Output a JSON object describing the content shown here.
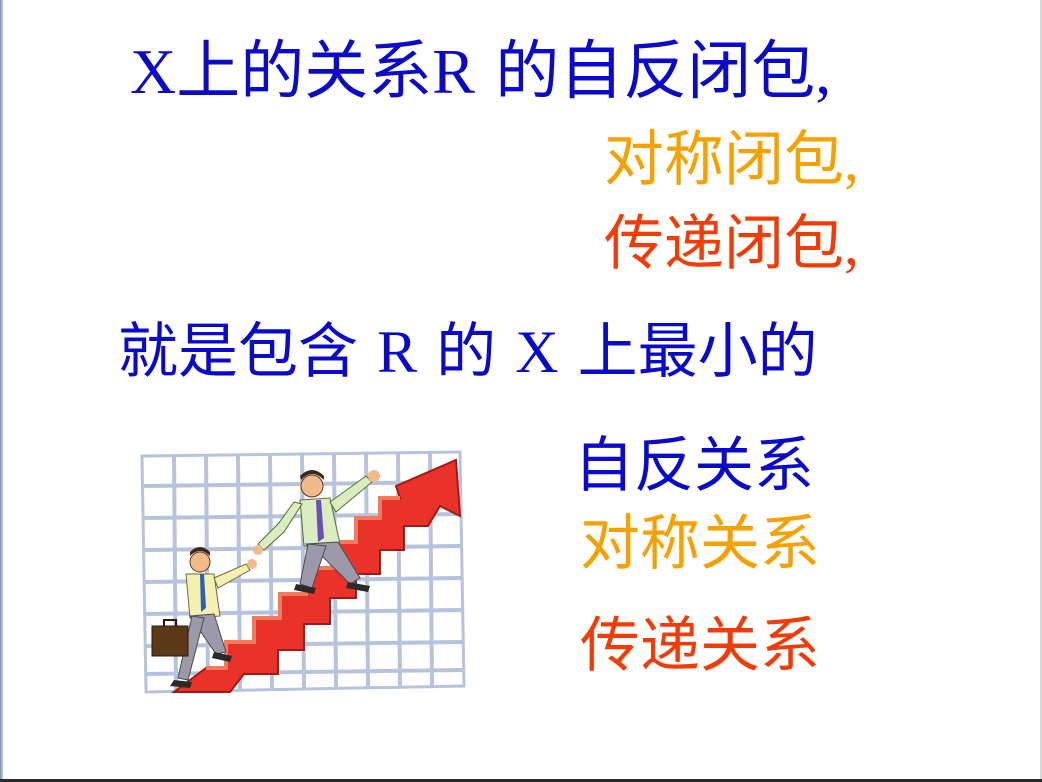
{
  "colors": {
    "blue": "#0a0ac8",
    "orange": "#f5a100",
    "red": "#f03c06",
    "arrow_red": "#e8322a",
    "grid_blue": "#b7c3dc"
  },
  "lines": {
    "l1": {
      "pre": "X",
      "han1": "上的关系",
      "latin": "R",
      "han2": " 的自反闭包",
      "tail": ","
    },
    "l2": {
      "han": "对称闭包",
      "tail": ","
    },
    "l3": {
      "han": "传递闭包",
      "tail": ","
    },
    "l4": {
      "a": "就是包含 ",
      "b": "R",
      "c": " 的 ",
      "d": "X",
      "e": " 上最小的"
    },
    "l5": "自反关系",
    "l6": "对称关系",
    "l7": "传递关系"
  },
  "clipart": {
    "icon": "business-growth-staircase-icon"
  }
}
